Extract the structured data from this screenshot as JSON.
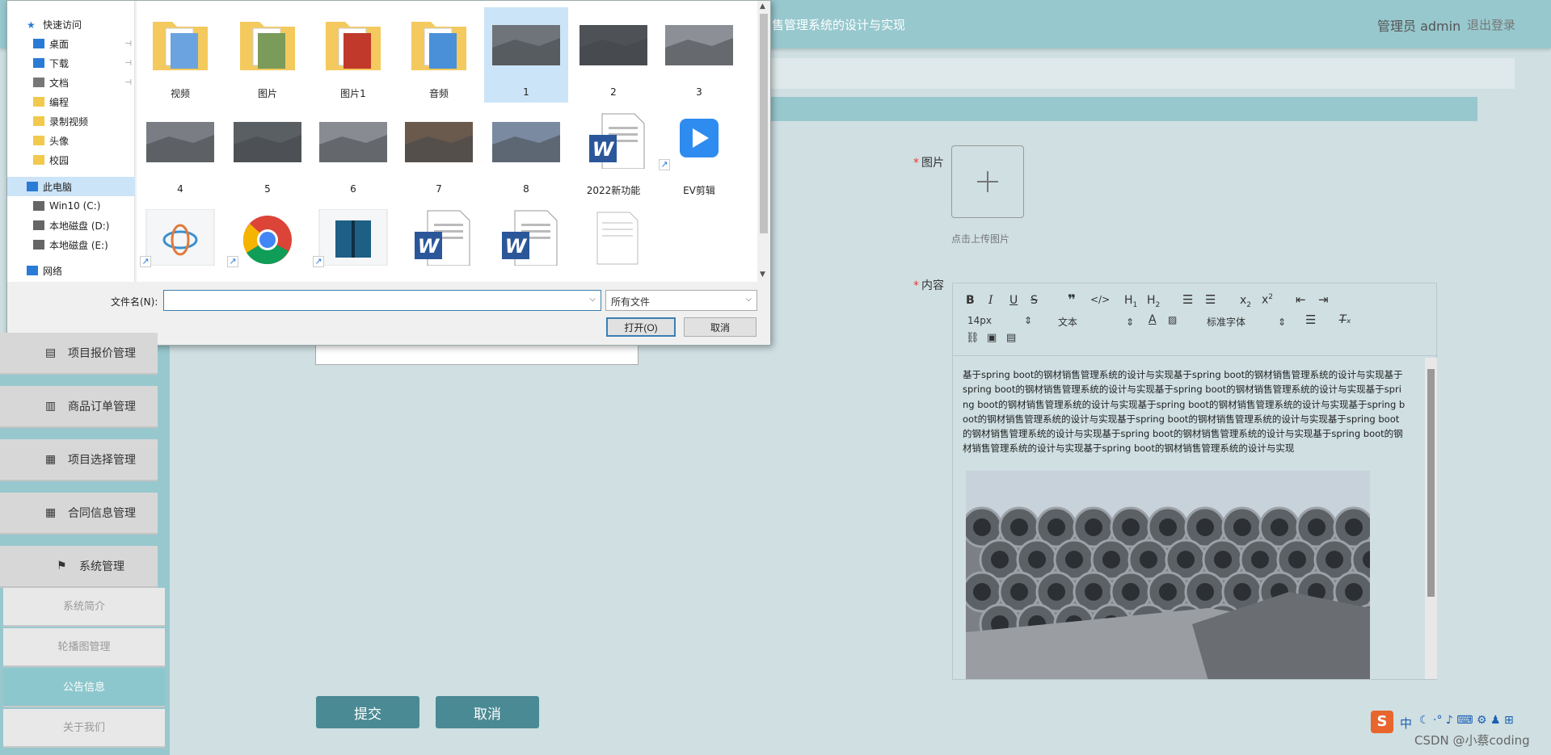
{
  "app": {
    "title": "销售管理系统的设计与实现",
    "admin_label": "管理员 admin",
    "logout_label": "退出登录"
  },
  "sidebar": {
    "items": [
      {
        "label": "项目报价管理",
        "icon": "clipboard-icon"
      },
      {
        "label": "商品订单管理",
        "icon": "clipboard-x-icon"
      },
      {
        "label": "项目选择管理",
        "icon": "grid-icon"
      },
      {
        "label": "合同信息管理",
        "icon": "grid-icon"
      },
      {
        "label": "系统管理",
        "icon": "flag-icon"
      }
    ],
    "subitems": [
      {
        "label": "系统简介",
        "active": false
      },
      {
        "label": "轮播图管理",
        "active": false
      },
      {
        "label": "公告信息",
        "active": true
      },
      {
        "label": "关于我们",
        "active": false
      }
    ]
  },
  "form": {
    "image_label": "图片",
    "upload_hint": "点击上传图片",
    "content_label": "内容",
    "submit_label": "提交",
    "cancel_label": "取消"
  },
  "editor": {
    "font_size": "14px",
    "text_type": "文本",
    "font_family": "标准字体",
    "content": "基于spring boot的钢材销售管理系统的设计与实现基于spring boot的钢材销售管理系统的设计与实现基于spring boot的钢材销售管理系统的设计与实现基于spring boot的钢材销售管理系统的设计与实现基于spring boot的钢材销售管理系统的设计与实现基于spring boot的钢材销售管理系统的设计与实现基于spring boot的钢材销售管理系统的设计与实现基于spring boot的钢材销售管理系统的设计与实现基于spring boot的钢材销售管理系统的设计与实现基于spring boot的钢材销售管理系统的设计与实现基于spring boot的钢材销售管理系统的设计与实现基于spring boot的钢材销售管理系统的设计与实现"
  },
  "dialog": {
    "nav": [
      {
        "label": "快速访问",
        "icon": "star-icon",
        "indent": 0,
        "pin": false
      },
      {
        "label": "桌面",
        "icon": "desktop-icon",
        "indent": 1,
        "pin": true
      },
      {
        "label": "下载",
        "icon": "download-icon",
        "indent": 1,
        "pin": true
      },
      {
        "label": "文档",
        "icon": "document-icon",
        "indent": 1,
        "pin": true
      },
      {
        "label": "编程",
        "icon": "folder-icon",
        "indent": 1,
        "pin": false
      },
      {
        "label": "录制视频",
        "icon": "folder-icon",
        "indent": 1,
        "pin": false
      },
      {
        "label": "头像",
        "icon": "folder-icon",
        "indent": 1,
        "pin": false
      },
      {
        "label": "校园",
        "icon": "folder-icon",
        "indent": 1,
        "pin": false
      },
      {
        "label": "此电脑",
        "icon": "computer-icon",
        "indent": 0,
        "pin": false,
        "selected": true
      },
      {
        "label": "Win10 (C:)",
        "icon": "drive-icon",
        "indent": 1,
        "pin": false
      },
      {
        "label": "本地磁盘 (D:)",
        "icon": "drive-icon",
        "indent": 1,
        "pin": false
      },
      {
        "label": "本地磁盘 (E:)",
        "icon": "drive-icon",
        "indent": 1,
        "pin": false
      },
      {
        "label": "网络",
        "icon": "network-icon",
        "indent": 0,
        "pin": false
      }
    ],
    "files": [
      {
        "label": "视频",
        "kind": "folder",
        "selected": false
      },
      {
        "label": "图片",
        "kind": "folder",
        "selected": false
      },
      {
        "label": "图片1",
        "kind": "folder",
        "selected": false
      },
      {
        "label": "音频",
        "kind": "folder",
        "selected": false
      },
      {
        "label": "1",
        "kind": "image",
        "selected": true
      },
      {
        "label": "2",
        "kind": "image",
        "selected": false
      },
      {
        "label": "3",
        "kind": "image",
        "selected": false
      },
      {
        "label": "4",
        "kind": "image",
        "selected": false
      },
      {
        "label": "5",
        "kind": "image",
        "selected": false
      },
      {
        "label": "6",
        "kind": "image",
        "selected": false
      },
      {
        "label": "7",
        "kind": "image",
        "selected": false
      },
      {
        "label": "8",
        "kind": "image",
        "selected": false
      },
      {
        "label": "2022新功能",
        "kind": "word",
        "selected": false
      },
      {
        "label": "EV剪辑",
        "kind": "ev",
        "selected": false
      },
      {
        "label": "",
        "kind": "app",
        "selected": false
      },
      {
        "label": "",
        "kind": "chrome",
        "selected": false
      },
      {
        "label": "",
        "kind": "book",
        "selected": false
      },
      {
        "label": "",
        "kind": "word",
        "selected": false
      },
      {
        "label": "",
        "kind": "word",
        "selected": false
      },
      {
        "label": "",
        "kind": "doc",
        "selected": false
      }
    ],
    "filename_label": "文件名(N):",
    "filename_value": "",
    "filetype_value": "所有文件",
    "open_label": "打开(O)",
    "cancel_label": "取消"
  },
  "watermark": "CSDN @小蔡coding",
  "tray_ime": "中"
}
